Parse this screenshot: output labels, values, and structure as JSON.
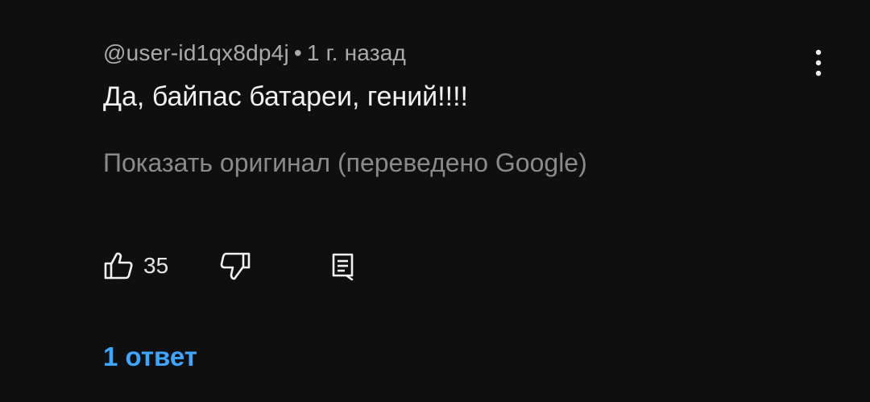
{
  "comment": {
    "author": "@user-id1qx8dp4j",
    "separator": "•",
    "time": "1 г. назад",
    "text": "Да, байпас батареи, гений!!!!",
    "translation_toggle": "Показать оригинал (переведено Google)",
    "likes": "35",
    "replies_label": "1 ответ"
  },
  "icons": {
    "menu": "more-vert-icon",
    "like": "thumb-up-icon",
    "dislike": "thumb-down-icon",
    "reply": "comment-icon"
  },
  "colors": {
    "background": "#0f0f0f",
    "primary_text": "#f1f1f1",
    "secondary_text": "#aaaaaa",
    "link": "#3ea6ff"
  }
}
